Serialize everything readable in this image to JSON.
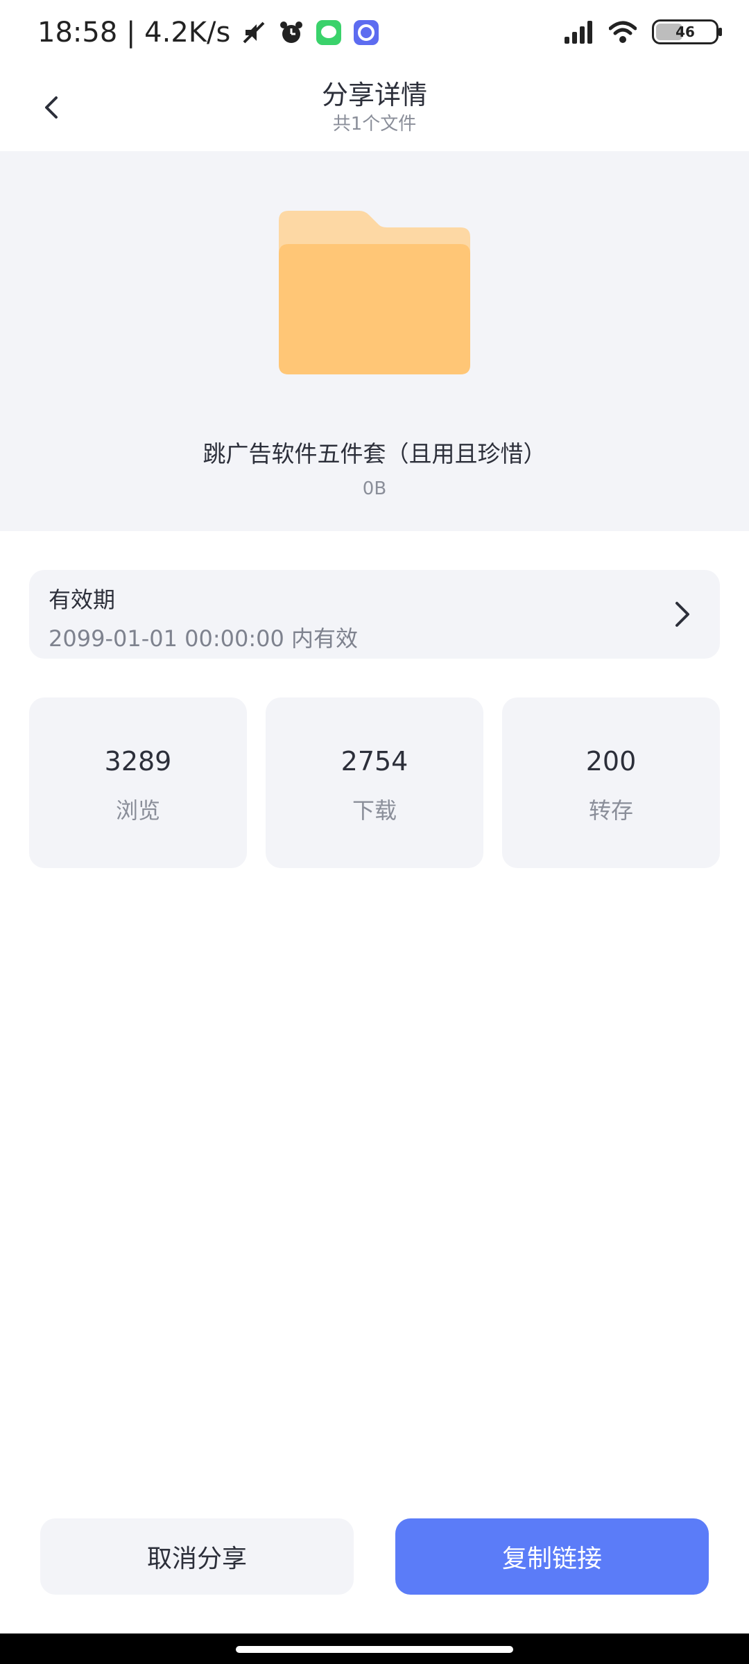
{
  "status_bar": {
    "time_speed": "18:58 | 4.2K/s",
    "battery": "46",
    "icons": [
      "mute-icon",
      "alarm-icon",
      "message-app-icon",
      "browser-app-icon",
      "signal-icon",
      "wifi-icon",
      "battery-icon"
    ]
  },
  "header": {
    "title": "分享详情",
    "subtitle": "共1个文件"
  },
  "file": {
    "name": "跳广告软件五件套（且用且珍惜）",
    "size": "0B",
    "icon": "folder-icon"
  },
  "validity": {
    "label": "有效期",
    "value": "2099-01-01 00:00:00 内有效"
  },
  "stats": [
    {
      "value": "3289",
      "label": "浏览"
    },
    {
      "value": "2754",
      "label": "下载"
    },
    {
      "value": "200",
      "label": "转存"
    }
  ],
  "actions": {
    "cancel_label": "取消分享",
    "copy_label": "复制链接"
  },
  "colors": {
    "accent": "#5b7cf8",
    "folder": "#ffc676",
    "folder_back": "#fdd8a4",
    "card_bg": "#f3f4f8"
  }
}
